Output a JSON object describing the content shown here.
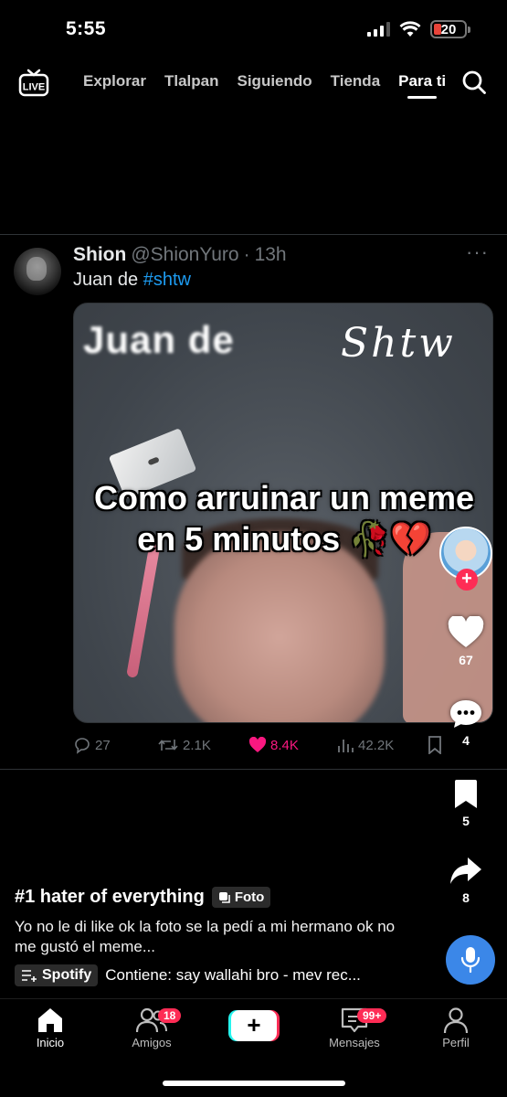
{
  "status_bar": {
    "time": "5:55",
    "battery": "20"
  },
  "top_nav": {
    "live_label": "LIVE",
    "tabs": [
      {
        "label": "Explorar",
        "active": false
      },
      {
        "label": "Tlalpan",
        "active": false
      },
      {
        "label": "Siguiendo",
        "active": false
      },
      {
        "label": "Tienda",
        "active": false
      },
      {
        "label": "Para ti",
        "active": true
      }
    ]
  },
  "tweet": {
    "name": "Shion",
    "handle": "@ShionYuro",
    "separator": "·",
    "time": "13h",
    "more": "···",
    "text_prefix": "Juan de ",
    "hashtag": "#shtw",
    "media": {
      "title_left": "Juan de",
      "title_right": "Shtw",
      "caption_line1": "Como arruinar un meme",
      "caption_line2": "en 5 minutos 🥀💔"
    },
    "actions": {
      "replies": "27",
      "retweets": "2.1K",
      "likes": "8.4K",
      "views": "42.2K"
    }
  },
  "rail": {
    "likes": "67",
    "comments": "4",
    "saves": "5",
    "shares": "8"
  },
  "post": {
    "title": "#1 hater of everything",
    "type_badge": "Foto",
    "description": "Yo no le di like ok la foto se la pedí a mi hermano ok no me gustó el meme...",
    "music_source": "Spotify",
    "music_text": "Contiene: say wallahi bro - mev rec..."
  },
  "bottom_nav": {
    "home": "Inicio",
    "friends": "Amigos",
    "friends_badge": "18",
    "messages": "Mensajes",
    "messages_badge": "99+",
    "profile": "Perfil"
  },
  "colors": {
    "accent_pink": "#fe2c55",
    "twitter_blue": "#1d9bf0",
    "like_pink": "#f91880"
  }
}
